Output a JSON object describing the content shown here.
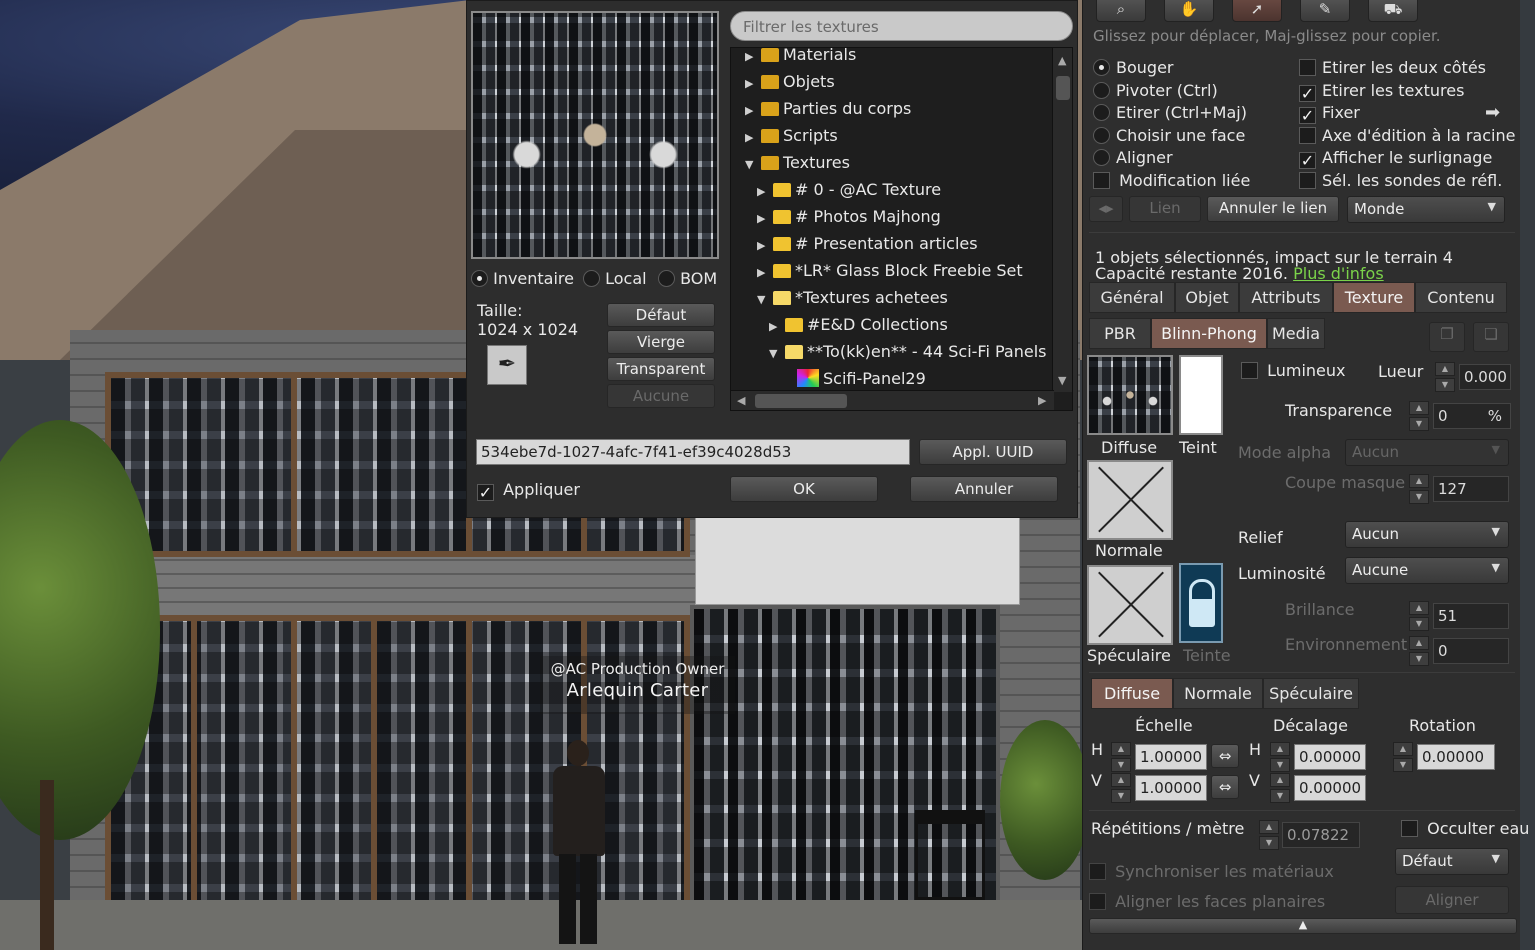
{
  "scene": {
    "nametag_group": "@AC Production Owner",
    "nametag_name": "Arlequin Carter"
  },
  "picker": {
    "filter_placeholder": "Filtrer les textures",
    "tree": [
      {
        "label": "Materials",
        "depth": 0,
        "arrow": "▶",
        "kind": "cat"
      },
      {
        "label": "Objets",
        "depth": 0,
        "arrow": "▶",
        "kind": "cat"
      },
      {
        "label": "Parties du corps",
        "depth": 0,
        "arrow": "▶",
        "kind": "cat"
      },
      {
        "label": "Scripts",
        "depth": 0,
        "arrow": "▶",
        "kind": "cat"
      },
      {
        "label": "Textures",
        "depth": 0,
        "arrow": "▼",
        "kind": "cat"
      },
      {
        "label": "# 0 - @AC Texture",
        "depth": 1,
        "arrow": "▶",
        "kind": "folder"
      },
      {
        "label": "# Photos Majhong",
        "depth": 1,
        "arrow": "▶",
        "kind": "folder"
      },
      {
        "label": "# Presentation articles",
        "depth": 1,
        "arrow": "▶",
        "kind": "folder"
      },
      {
        "label": "*LR* Glass Block Freebie Set",
        "depth": 1,
        "arrow": "▶",
        "kind": "folder"
      },
      {
        "label": "*Textures achetees",
        "depth": 1,
        "arrow": "▼",
        "kind": "open"
      },
      {
        "label": "#E&D Collections",
        "depth": 2,
        "arrow": "▶",
        "kind": "folder"
      },
      {
        "label": "**To(kk)en** - 44 Sci-Fi Panels",
        "depth": 2,
        "arrow": "▼",
        "kind": "open"
      },
      {
        "label": "Scifi-Panel29",
        "depth": 3,
        "arrow": "",
        "kind": "texture"
      }
    ],
    "source_inventory": "Inventaire",
    "source_local": "Local",
    "source_bom": "BOM",
    "size_label": "Taille:",
    "size_value": "1024 x 1024",
    "btn_default": "Défaut",
    "btn_blank": "Vierge",
    "btn_transparent": "Transparent",
    "btn_none": "Aucune",
    "uuid_value": "534ebe7d-1027-4afc-7f41-ef39c4028d53",
    "btn_apply_uuid": "Appl. UUID",
    "apply_label": "Appliquer",
    "apply_checked": true,
    "btn_ok": "OK",
    "btn_cancel": "Annuler"
  },
  "build": {
    "hint": "Glissez pour déplacer, Maj-glissez pour copier.",
    "left_options": [
      {
        "label": "Bouger",
        "on": true
      },
      {
        "label": "Pivoter (Ctrl)",
        "on": false
      },
      {
        "label": "Etirer (Ctrl+Maj)",
        "on": false
      },
      {
        "label": "Choisir une face",
        "on": false
      },
      {
        "label": "Aligner",
        "on": false
      }
    ],
    "linked_edit": "Modification liée",
    "right_options": [
      {
        "label": "Etirer les deux côtés",
        "on": false
      },
      {
        "label": "Etirer les textures",
        "on": true
      },
      {
        "label": "Fixer",
        "on": true
      },
      {
        "label": "Axe d'édition à la racine",
        "on": false
      },
      {
        "label": "Afficher le surlignage",
        "on": true
      },
      {
        "label": "Sél. les sondes de réfl.",
        "on": false
      }
    ],
    "btn_link": "Lien",
    "btn_unlink": "Annuler le lien",
    "ruler_value": "Monde",
    "selection_info": "1 objets sélectionnés, impact sur le terrain 4",
    "capacity_text": "Capacité restante 2016.",
    "more_info": "Plus d'infos",
    "tabs": [
      "Général",
      "Objet",
      "Attributs",
      "Texture",
      "Contenu"
    ],
    "mat_tabs": [
      "PBR",
      "Blinn-Phong",
      "Media"
    ],
    "diffuse_label": "Diffuse",
    "tint_label": "Teint",
    "luminous_label": "Lumineux",
    "glow_label": "Lueur",
    "glow_value": "0.000",
    "transparency_label": "Transparence",
    "transparency_value": "0",
    "transparency_unit": "%",
    "alpha_mode_label": "Mode alpha",
    "alpha_mode_value": "Aucun",
    "mask_cutoff_label": "Coupe masque",
    "mask_cutoff_value": "127",
    "normal_label": "Normale",
    "bump_label": "Relief",
    "bump_value": "Aucun",
    "shiny_label": "Luminosité",
    "shiny_value": "Aucune",
    "specular_label": "Spéculaire",
    "tint2_label": "Teinte",
    "glossiness_label": "Brillance",
    "glossiness_value": "51",
    "environment_label": "Environnement",
    "environment_value": "0",
    "map_tabs": [
      "Diffuse",
      "Normale",
      "Spéculaire"
    ],
    "scale_label": "Échelle",
    "offset_label": "Décalage",
    "rotation_label": "Rotation",
    "h_label": "H",
    "v_label": "V",
    "scale_h": "1.00000",
    "scale_v": "1.00000",
    "offset_h": "0.00000",
    "offset_v": "0.00000",
    "rotation_value": "0.00000",
    "repeats_label": "Répétitions / mètre",
    "repeats_value": "0.07822",
    "hide_water_label": "Occulter eau",
    "default_combo": "Défaut",
    "sync_materials": "Synchroniser les matériaux",
    "align_planar": "Aligner les faces planaires",
    "btn_align": "Aligner"
  }
}
